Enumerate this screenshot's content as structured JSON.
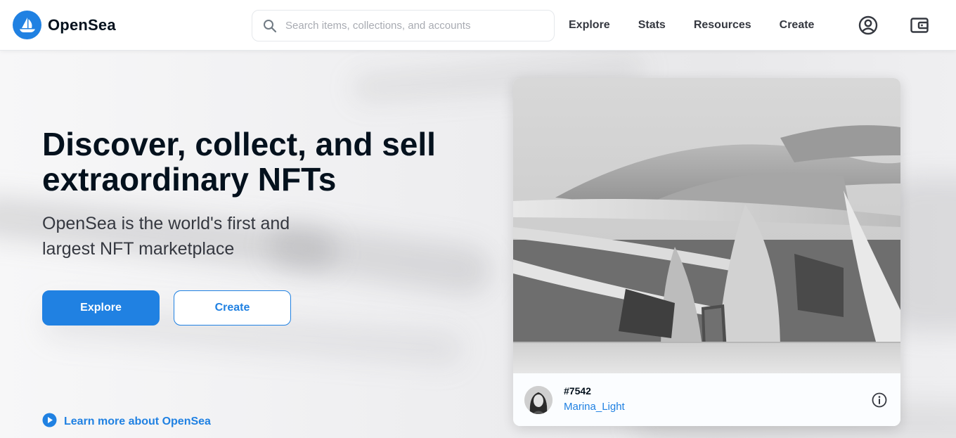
{
  "header": {
    "logo_text": "OpenSea",
    "search_placeholder": "Search items, collections, and accounts",
    "nav": [
      "Explore",
      "Stats",
      "Resources",
      "Create"
    ],
    "icons": [
      "account-icon",
      "wallet-icon"
    ]
  },
  "hero": {
    "title": "Discover, collect, and sell extraordinary NFTs",
    "subtitle": "OpenSea is the world's first and largest NFT marketplace",
    "explore_label": "Explore",
    "create_label": "Create",
    "learn_more_label": "Learn more about OpenSea"
  },
  "featured": {
    "item_number": "#7542",
    "creator": "Marina_Light"
  },
  "colors": {
    "accent": "#2081e2",
    "text_primary": "#04111d",
    "text_secondary": "#353840",
    "background": "#f3f3f4"
  }
}
